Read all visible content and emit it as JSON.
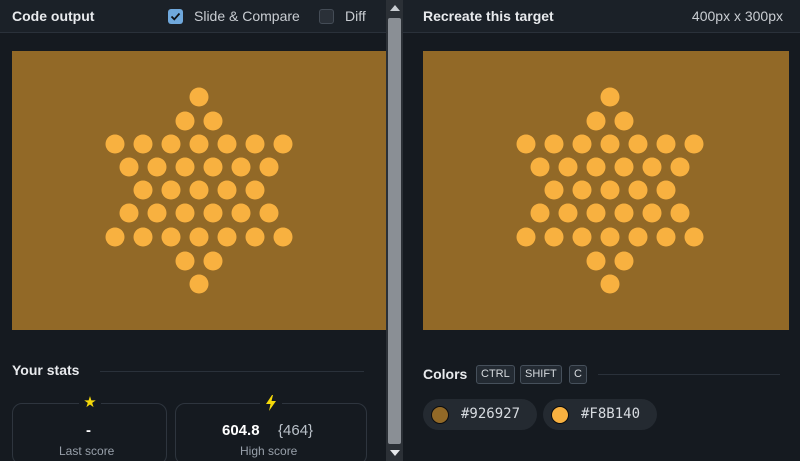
{
  "left_panel": {
    "title": "Code output",
    "slide_compare": {
      "label": "Slide & Compare",
      "checked": true
    },
    "diff": {
      "label": "Diff",
      "checked": false
    }
  },
  "right_panel": {
    "title": "Recreate this target",
    "dimensions": "400px x 300px"
  },
  "stats": {
    "title": "Your stats",
    "last_score": {
      "value": "-",
      "label": "Last score",
      "icon": "star-icon"
    },
    "high_score": {
      "value": "604.8",
      "sub": "{464}",
      "label": "High score",
      "icon": "lightning-icon"
    }
  },
  "colors": {
    "title": "Colors",
    "shortcut_keys": [
      "CTRL",
      "SHIFT",
      "C"
    ],
    "palette": [
      {
        "hex": "#926927",
        "label": "#926927"
      },
      {
        "hex": "#F8B140",
        "label": "#F8B140"
      }
    ]
  },
  "canvas": {
    "background": "#926927",
    "dot_color": "#F8B140"
  }
}
